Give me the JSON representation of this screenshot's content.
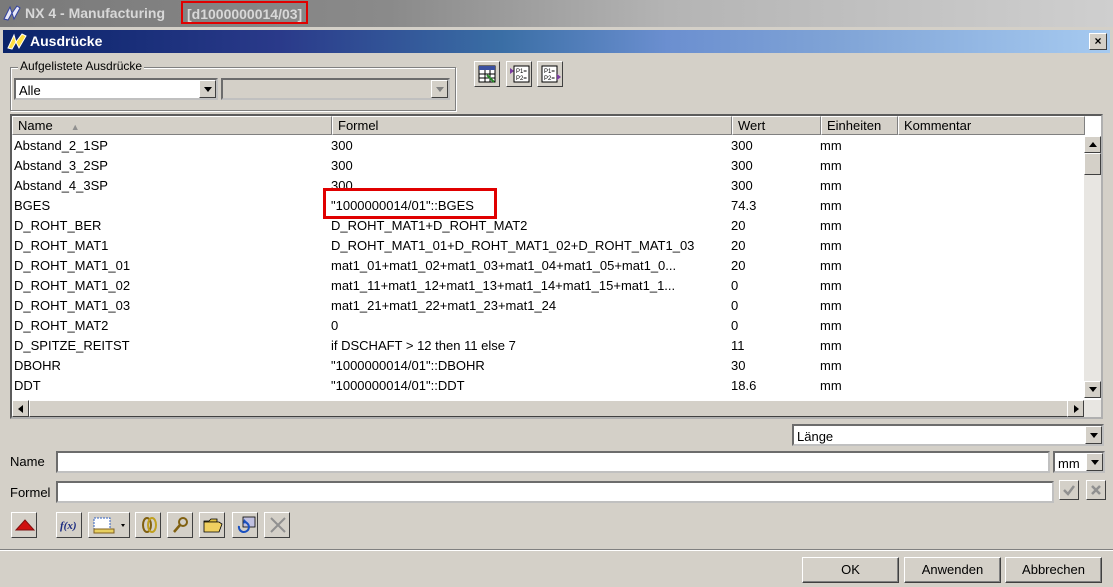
{
  "app": {
    "title": "NX 4 - Manufacturing",
    "part": "[d1000000014/03]"
  },
  "dialog": {
    "title": "Ausdrücke",
    "close_label": "×"
  },
  "filter": {
    "legend": "Aufgelistete Ausdrücke",
    "selected": "Alle",
    "secondary": ""
  },
  "table": {
    "columns": [
      "Name",
      "Formel",
      "Wert",
      "Einheiten",
      "Kommentar"
    ],
    "rows": [
      {
        "name": "Abstand_2_1SP",
        "formel": "300",
        "wert": "300",
        "einheiten": "mm",
        "kommentar": ""
      },
      {
        "name": "Abstand_3_2SP",
        "formel": "300",
        "wert": "300",
        "einheiten": "mm",
        "kommentar": ""
      },
      {
        "name": "Abstand_4_3SP",
        "formel": "300",
        "wert": "300",
        "einheiten": "mm",
        "kommentar": ""
      },
      {
        "name": "BGES",
        "formel": "\"1000000014/01\"::BGES",
        "wert": "74.3",
        "einheiten": "mm",
        "kommentar": ""
      },
      {
        "name": "D_ROHT_BER",
        "formel": "D_ROHT_MAT1+D_ROHT_MAT2",
        "wert": "20",
        "einheiten": "mm",
        "kommentar": ""
      },
      {
        "name": "D_ROHT_MAT1",
        "formel": "D_ROHT_MAT1_01+D_ROHT_MAT1_02+D_ROHT_MAT1_03",
        "wert": "20",
        "einheiten": "mm",
        "kommentar": ""
      },
      {
        "name": "D_ROHT_MAT1_01",
        "formel": "mat1_01+mat1_02+mat1_03+mat1_04+mat1_05+mat1_0...",
        "wert": "20",
        "einheiten": "mm",
        "kommentar": ""
      },
      {
        "name": "D_ROHT_MAT1_02",
        "formel": "mat1_11+mat1_12+mat1_13+mat1_14+mat1_15+mat1_1...",
        "wert": "0",
        "einheiten": "mm",
        "kommentar": ""
      },
      {
        "name": "D_ROHT_MAT1_03",
        "formel": "mat1_21+mat1_22+mat1_23+mat1_24",
        "wert": "0",
        "einheiten": "mm",
        "kommentar": ""
      },
      {
        "name": "D_ROHT_MAT2",
        "formel": "0",
        "wert": "0",
        "einheiten": "mm",
        "kommentar": ""
      },
      {
        "name": "D_SPITZE_REITST",
        "formel": "if DSCHAFT > 12 then 11 else 7",
        "wert": "11",
        "einheiten": "mm",
        "kommentar": ""
      },
      {
        "name": "DBOHR",
        "formel": "\"1000000014/01\"::DBOHR",
        "wert": "30",
        "einheiten": "mm",
        "kommentar": ""
      },
      {
        "name": "DDT",
        "formel": "\"1000000014/01\"::DDT",
        "wert": "18.6",
        "einheiten": "mm",
        "kommentar": ""
      }
    ]
  },
  "dimension_select": "Länge",
  "name_field": {
    "label": "Name",
    "value": "",
    "unit": "mm"
  },
  "formel_field": {
    "label": "Formel",
    "value": ""
  },
  "icons": {
    "spreadsheet": "spreadsheet-icon",
    "import": "import-p1p2-icon",
    "export": "export-p1p2-icon",
    "collapse": "collapse-triangle-icon",
    "function": "function-fx-icon",
    "measure": "measure-dropdown-icon",
    "link1": "link-expression-icon",
    "link2": "link-inter-part-icon",
    "open_folder": "open-folder-icon",
    "refresh": "refresh-icon",
    "delete": "delete-icon",
    "accept": "checkmark-icon",
    "reject": "reject-x-icon"
  },
  "buttons": {
    "ok": "OK",
    "apply": "Anwenden",
    "cancel": "Abbrechen"
  }
}
